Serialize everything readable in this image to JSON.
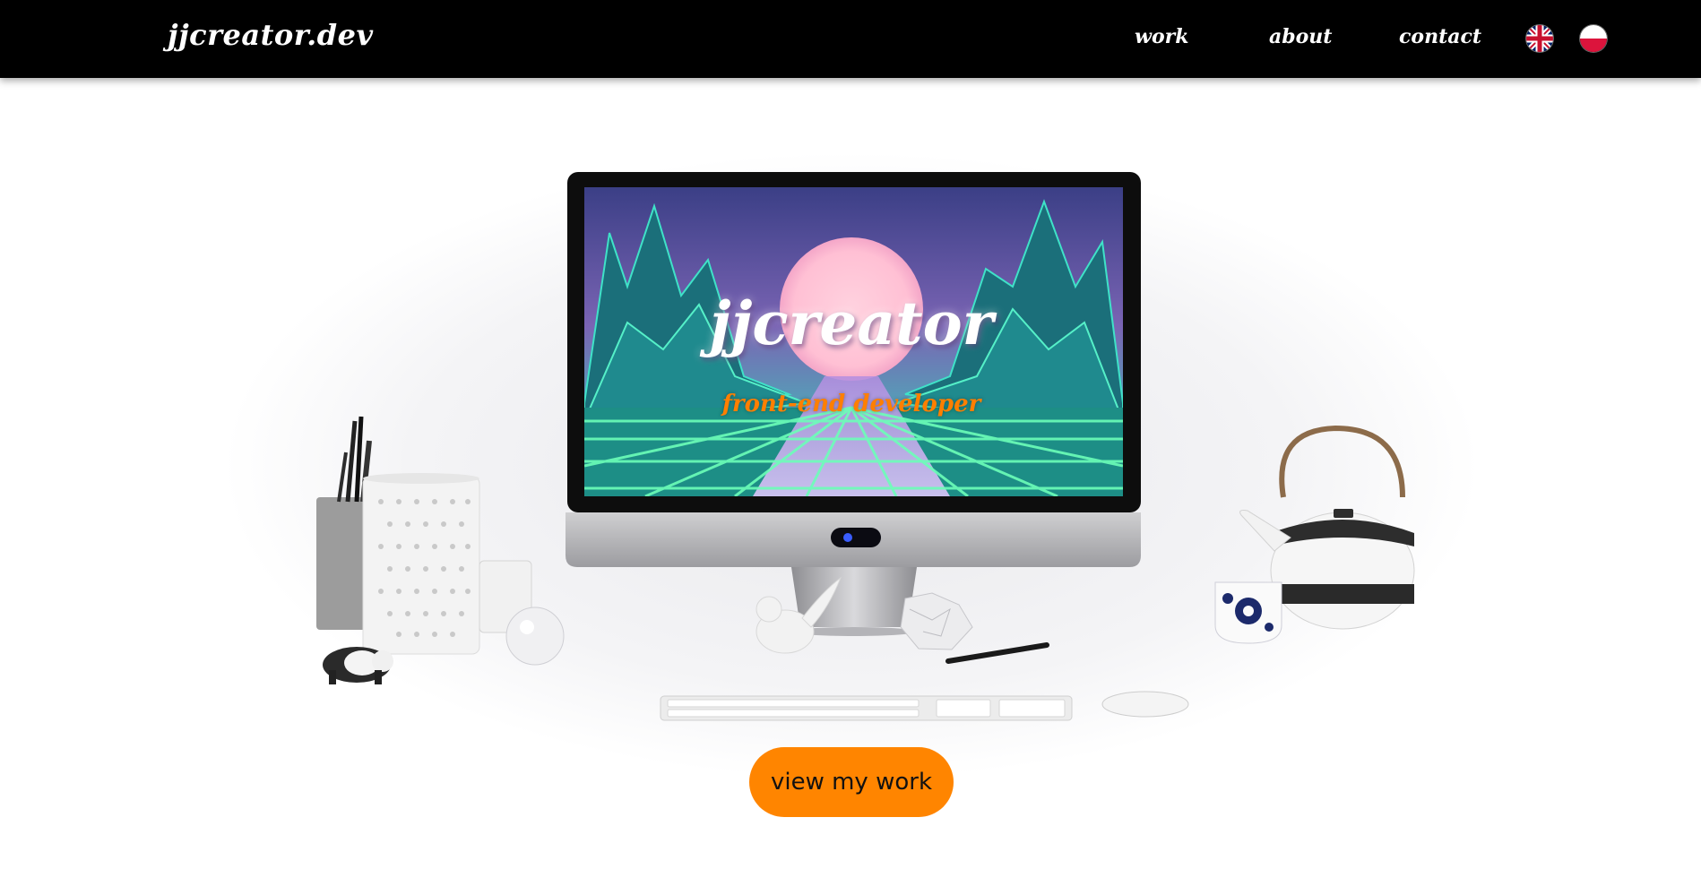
{
  "nav": {
    "logo": "jjcreator.dev",
    "links": [
      "work",
      "about",
      "contact"
    ],
    "languages": [
      {
        "code": "en",
        "icon": "uk-flag-icon"
      },
      {
        "code": "pl",
        "icon": "poland-flag-icon"
      }
    ]
  },
  "hero": {
    "screen_title": "jjcreator",
    "screen_subtitle": "front-end developer",
    "cta_label": "view my work"
  },
  "colors": {
    "nav_background": "#000000",
    "cta_background": "#ff8500",
    "subtitle_color": "#ff7f00"
  }
}
